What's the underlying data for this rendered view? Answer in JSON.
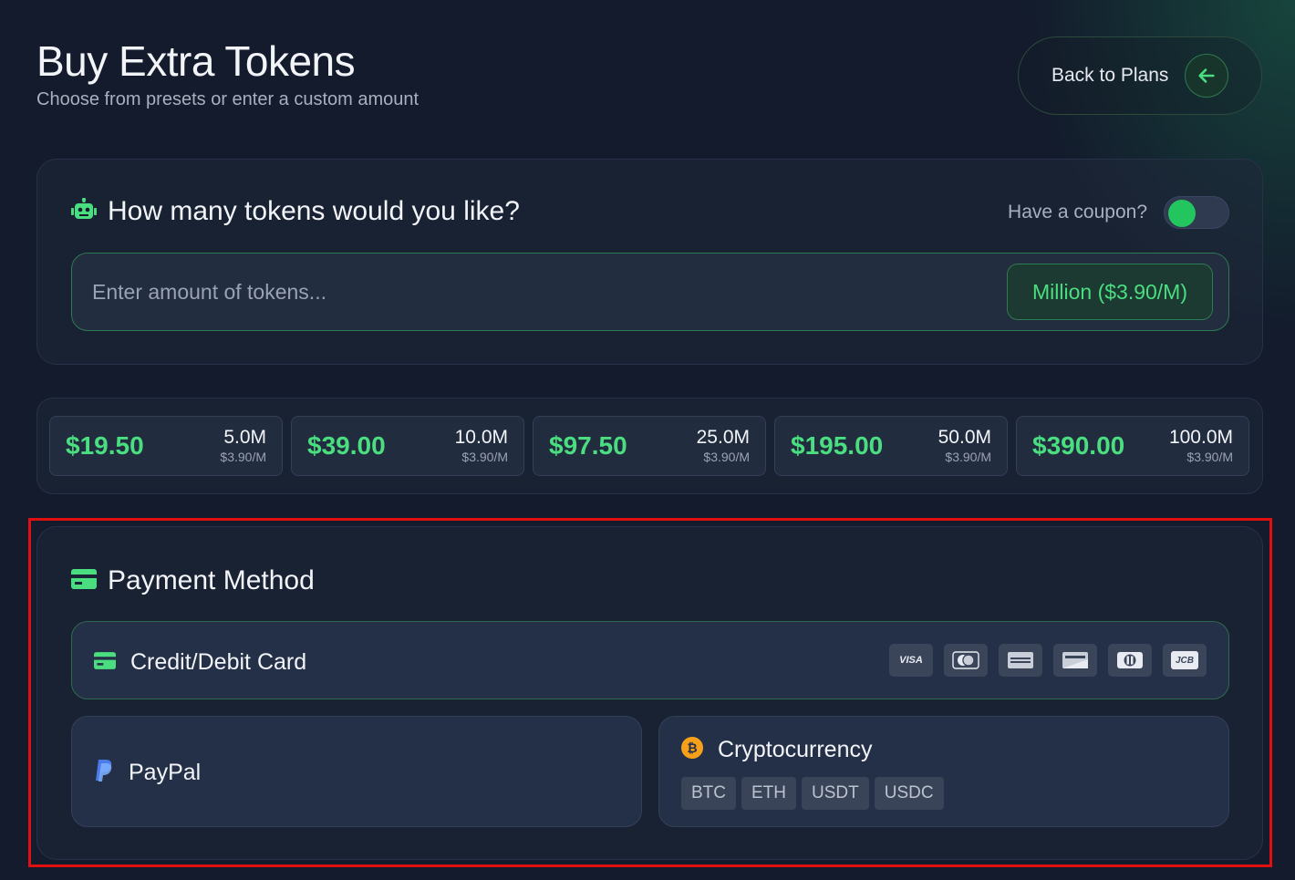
{
  "page": {
    "title": "Buy Extra Tokens",
    "subtitle": "Choose from presets or enter a custom amount"
  },
  "back_button": {
    "label": "Back to Plans",
    "icon": "arrow-left-icon"
  },
  "tokens": {
    "heading": "How many tokens would you like?",
    "heading_icon": "robot-icon",
    "coupon_label": "Have a coupon?",
    "coupon_toggle_on": false,
    "amount_placeholder": "Enter amount of tokens...",
    "amount_value": "",
    "unit_label": "Million ($3.90/M)"
  },
  "presets": [
    {
      "price": "$19.50",
      "amount": "5.0M",
      "rate": "$3.90/M"
    },
    {
      "price": "$39.00",
      "amount": "10.0M",
      "rate": "$3.90/M"
    },
    {
      "price": "$97.50",
      "amount": "25.0M",
      "rate": "$3.90/M"
    },
    {
      "price": "$195.00",
      "amount": "50.0M",
      "rate": "$3.90/M"
    },
    {
      "price": "$390.00",
      "amount": "100.0M",
      "rate": "$3.90/M"
    }
  ],
  "payment": {
    "heading": "Payment Method",
    "heading_icon": "credit-card-icon",
    "card": {
      "label": "Credit/Debit Card",
      "icon": "credit-card-icon",
      "brands": [
        {
          "name": "visa-icon",
          "text": "VISA"
        },
        {
          "name": "mastercard-icon"
        },
        {
          "name": "amex-icon"
        },
        {
          "name": "discover-icon"
        },
        {
          "name": "diners-club-icon"
        },
        {
          "name": "jcb-icon",
          "text": "JCB"
        }
      ]
    },
    "paypal": {
      "label": "PayPal",
      "icon": "paypal-icon"
    },
    "crypto": {
      "label": "Cryptocurrency",
      "icon": "bitcoin-icon",
      "coins": [
        "BTC",
        "ETH",
        "USDT",
        "USDC"
      ]
    }
  },
  "colors": {
    "accent": "#22c55e",
    "accent_text": "#4ade80",
    "background": "#131b2c",
    "highlight": "#e01010"
  }
}
